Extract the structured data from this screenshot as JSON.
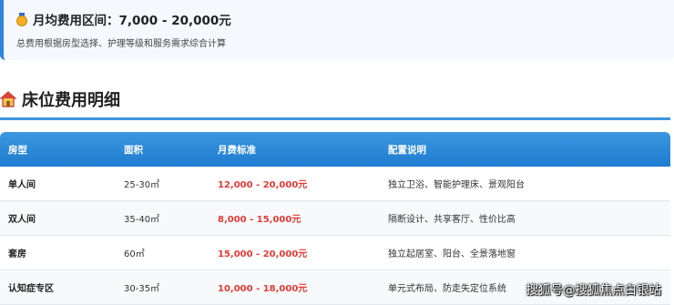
{
  "summary": {
    "title": "月均费用区间：7,000 - 20,000元",
    "note": "总费用根据房型选择、护理等级和服务需求综合计算"
  },
  "section": {
    "title": "床位费用明细"
  },
  "table": {
    "headers": [
      "房型",
      "面积",
      "月费标准",
      "配置说明"
    ],
    "rows": [
      [
        "单人间",
        "25-30㎡",
        "12,000 - 20,000元",
        "独立卫浴、智能护理床、景观阳台"
      ],
      [
        "双人间",
        "35-40㎡",
        "8,000 - 15,000元",
        "隔断设计、共享客厅、性价比高"
      ],
      [
        "套房",
        "60㎡",
        "15,000 - 20,000元",
        "独立起居室、阳台、全景落地窗"
      ],
      [
        "认知症专区",
        "30-35㎡",
        "10,000 - 18,000元",
        "单元式布局、防走失定位系统"
      ]
    ]
  },
  "watermark": "搜狐号@搜狐焦点白银站",
  "colors": {
    "accent": "#2e86d8",
    "price": "#e53935",
    "header_bg": "#2a8ad8"
  },
  "icons": {
    "summary": "money-medal-icon",
    "section": "house-icon"
  }
}
